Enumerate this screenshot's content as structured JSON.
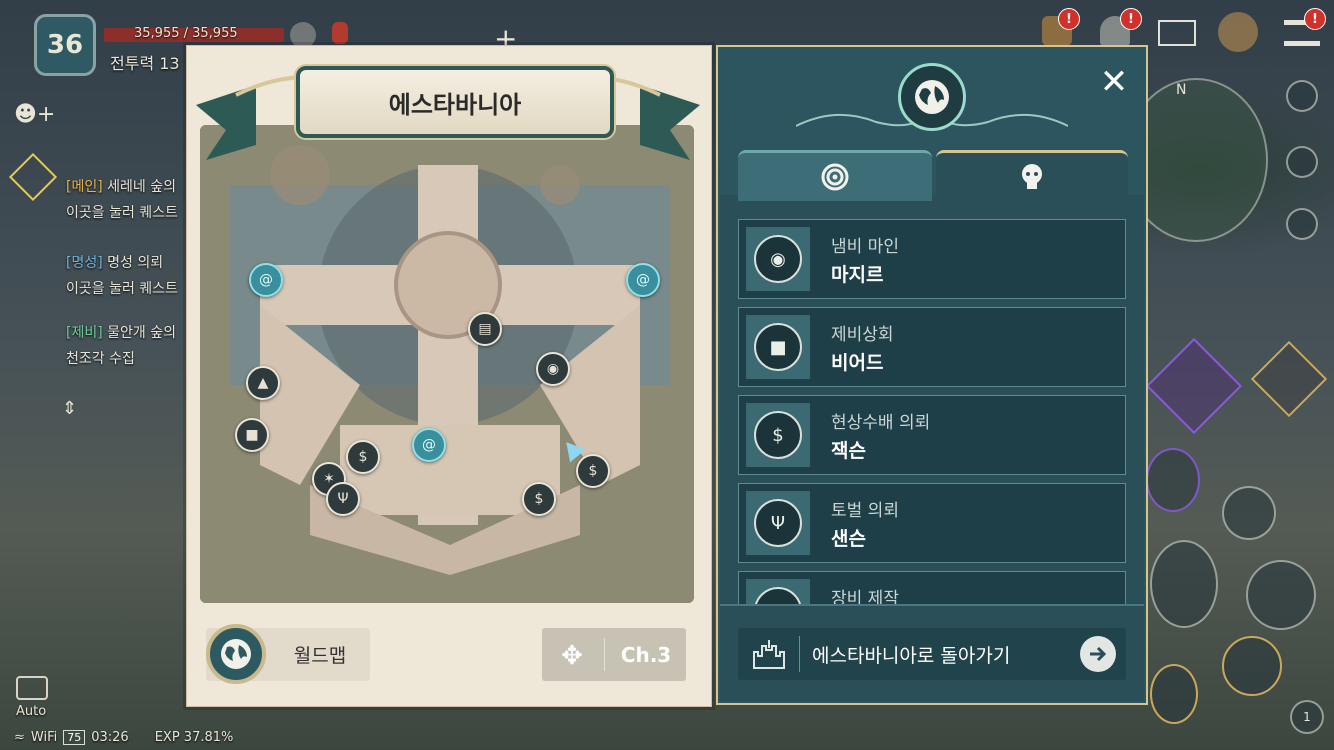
{
  "hud": {
    "level": "36",
    "hp_text": "35,955 / 35,955",
    "power_label": "전투력 13",
    "status_bar": {
      "wifi": "WiFi",
      "battery": "75",
      "time": "03:26",
      "exp": "EXP 37.81%"
    },
    "auto_label": "Auto",
    "alerts": [
      "!",
      "!",
      "!"
    ],
    "corner_badge": "1",
    "minimap_north": "N"
  },
  "quests": [
    {
      "tag": "[메인]",
      "title": "세레네 숲의",
      "desc": "이곳을 눌러 퀘스트"
    },
    {
      "tag": "[명성]",
      "title": "명성 의뢰",
      "desc": "이곳을 눌러 퀘스트"
    },
    {
      "tag": "[제비]",
      "title": "물안개 숲의",
      "desc": "천조각 수집"
    }
  ],
  "map": {
    "title": "에스타바니아",
    "world_map_label": "월드맵",
    "channel_label": "Ch.3"
  },
  "panel": {
    "tabs": [
      {
        "name": "portal",
        "icon": "portal-swirl-icon"
      },
      {
        "name": "npc",
        "icon": "npc-skull-icon"
      }
    ],
    "npcs": [
      {
        "role": "냄비 마인",
        "name": "마지르",
        "icon": "pot-icon"
      },
      {
        "role": "제비상회",
        "name": "비어드",
        "icon": "merchant-icon"
      },
      {
        "role": "현상수배 의뢰",
        "name": "잭슨",
        "icon": "money-bag-icon"
      },
      {
        "role": "토벌 의뢰",
        "name": "샌슨",
        "icon": "trident-icon"
      },
      {
        "role": "장비 제작",
        "name": "",
        "icon": "anvil-icon"
      }
    ],
    "return_label": "에스타바니아로 돌아가기"
  },
  "colors": {
    "panel_bg": "#2d5560",
    "accent_gold": "#d6c58e",
    "map_card_bg": "#efe7d7"
  }
}
